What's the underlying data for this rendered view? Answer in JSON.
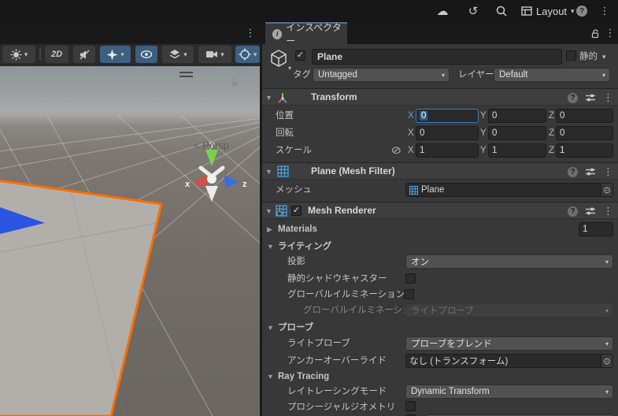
{
  "topbar": {
    "layout_button": "Layout"
  },
  "icons": {
    "kebab": "⋮",
    "caret": "▾",
    "foldout_open": "▼",
    "foldout_closed": "▶",
    "check": "✓",
    "picker": "⊙",
    "constrain": "⊘",
    "help": "?",
    "info": "i",
    "history": "↺",
    "cloud": "☁"
  },
  "scene_view": {
    "toolbar": {
      "toggle_2d": "2D"
    },
    "gizmo": {
      "x": "x",
      "y": "y",
      "z": "z",
      "persp": "< Persp"
    }
  },
  "inspector": {
    "tab": "インスペクター",
    "game_object": {
      "name": "Plane",
      "static_label": "静的",
      "tag_label": "タグ",
      "tag_value": "Untagged",
      "layer_label": "レイヤー",
      "layer_value": "Default"
    },
    "transform": {
      "title": "Transform",
      "axis": {
        "x": "X",
        "y": "Y",
        "z": "Z"
      },
      "position": {
        "label": "位置",
        "x": "0",
        "y": "0",
        "z": "0"
      },
      "rotation": {
        "label": "回転",
        "x": "0",
        "y": "0",
        "z": "0"
      },
      "scale": {
        "label": "スケール",
        "x": "1",
        "y": "1",
        "z": "1"
      }
    },
    "mesh_filter": {
      "title": "Plane (Mesh Filter)",
      "mesh_label": "メッシュ",
      "mesh_value": "Plane"
    },
    "mesh_renderer": {
      "title": "Mesh Renderer",
      "materials_label": "Materials",
      "materials_count": "1",
      "lighting_title": "ライティング",
      "cast_shadows_label": "投影",
      "cast_shadows_value": "オン",
      "static_shadow_caster_label": "静的シャドウキャスター",
      "contribute_gi_label": "グローバルイルミネーションに影響",
      "receive_gi_label": "グローバルイルミネーションを受",
      "receive_gi_value": "ライトプローブ",
      "probes_title": "プローブ",
      "light_probes_label": "ライトプローブ",
      "light_probes_value": "プローブをブレンド",
      "anchor_override_label": "アンカーオーバーライド",
      "anchor_override_value": "なし (トランスフォーム)",
      "ray_tracing_title": "Ray Tracing",
      "ray_tracing_mode_label": "レイトレーシングモード",
      "ray_tracing_mode_value": "Dynamic Transform",
      "procedural_geometry_label": "プロシージャルジオメトリ"
    }
  },
  "colors": {
    "accent_blue": "#3a79bb",
    "selection_blue": "#2c5d87",
    "selected_outline_orange": "#ff6d00",
    "toolbar_active_blue": "#3e5f7d"
  }
}
